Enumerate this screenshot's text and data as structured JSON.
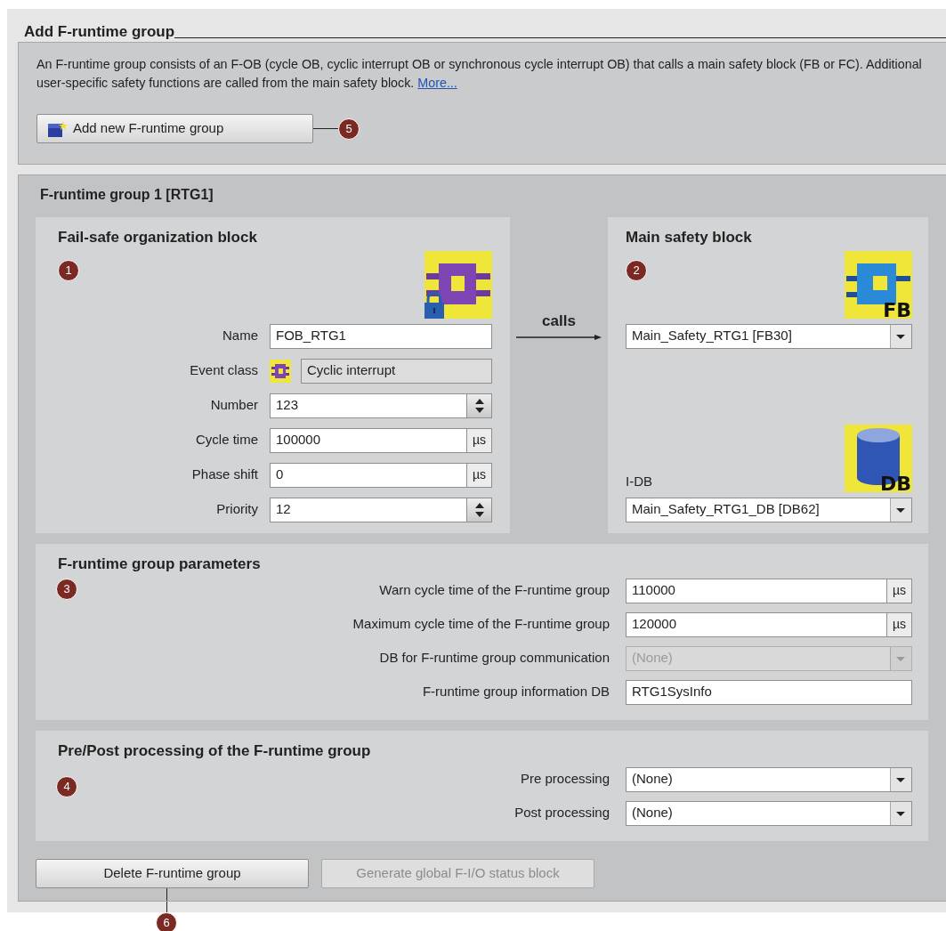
{
  "title": "Add F-runtime group",
  "description": {
    "text": "An F-runtime group consists of an F-OB (cycle OB, cyclic interrupt OB or synchronous cycle interrupt OB) that calls a main safety block (FB or FC). Additional user-specific safety functions are called from the main safety block.",
    "link": "More..."
  },
  "add_button": {
    "label": "Add new F-runtime group",
    "callout": "5"
  },
  "group": {
    "title": "F-runtime group 1 [RTG1]",
    "fob": {
      "heading": "Fail-safe organization block",
      "callout": "1",
      "fields": [
        {
          "kind": "text",
          "label": "Name",
          "value": "FOB_RTG1"
        },
        {
          "kind": "readonly",
          "label": "Event class",
          "value": "Cyclic interrupt"
        },
        {
          "kind": "spin",
          "label": "Number",
          "value": "123"
        },
        {
          "kind": "unit",
          "label": "Cycle time",
          "value": "100000",
          "unit": "µs"
        },
        {
          "kind": "unit",
          "label": "Phase shift",
          "value": "0",
          "unit": "µs"
        },
        {
          "kind": "spin",
          "label": "Priority",
          "value": "12"
        }
      ]
    },
    "calls_label": "calls",
    "main": {
      "heading": "Main safety block",
      "callout": "2",
      "block_icon_label": "FB",
      "block": {
        "kind": "dropdown",
        "value": "Main_Safety_RTG1 [FB30]",
        "disabled": false
      },
      "idb_label": "I-DB",
      "idb_icon_label": "DB",
      "idb": {
        "kind": "dropdown",
        "value": "Main_Safety_RTG1_DB [DB62]",
        "disabled": false
      }
    },
    "params": {
      "heading": "F-runtime group parameters",
      "callout": "3",
      "fields": [
        {
          "kind": "unit",
          "label": "Warn cycle time of the F-runtime group",
          "value": "110000",
          "unit": "µs"
        },
        {
          "kind": "unit",
          "label": "Maximum cycle time of the F-runtime group",
          "value": "120000",
          "unit": "µs"
        },
        {
          "kind": "dropdown",
          "label": "DB for F-runtime group communication",
          "value": "(None)",
          "disabled": true
        },
        {
          "kind": "text",
          "label": "F-runtime group information DB",
          "value": "RTG1SysInfo"
        }
      ]
    },
    "prepost": {
      "heading": "Pre/Post processing of the F-runtime group",
      "callout": "4",
      "fields": [
        {
          "kind": "dropdown",
          "label": "Pre processing",
          "value": "(None)",
          "disabled": false
        },
        {
          "kind": "dropdown",
          "label": "Post processing",
          "value": "(None)",
          "disabled": false
        }
      ]
    },
    "buttons": [
      {
        "label": "Delete F-runtime group",
        "disabled": false,
        "callout": "6"
      },
      {
        "label": "Generate global F-I/O status block",
        "disabled": true
      }
    ]
  }
}
